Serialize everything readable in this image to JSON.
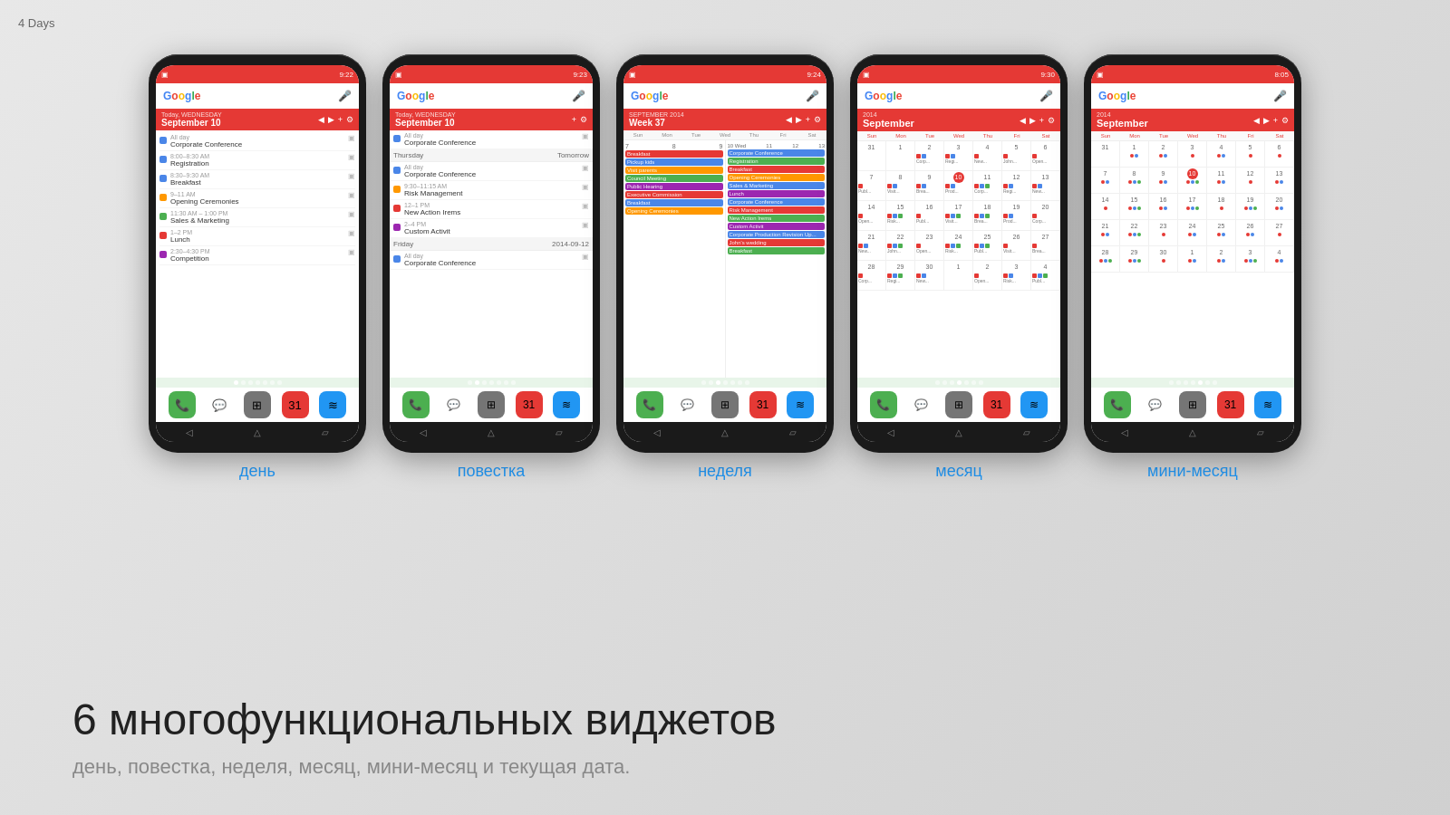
{
  "topbar": {
    "days_label": "4 Days"
  },
  "phones": [
    {
      "id": "day",
      "label": "день",
      "status_time": "9:22",
      "widget_type": "day",
      "header_day": "Today, WEDNESDAY",
      "header_date": "September 10",
      "events": [
        {
          "dot_color": "#4a86e8",
          "time": "All day",
          "title": "Corporate Conference",
          "allday": true
        },
        {
          "dot_color": "#4a86e8",
          "time": "8:00–8:30 AM",
          "title": "Registration"
        },
        {
          "dot_color": "#4a86e8",
          "time": "8:30–9:30 AM",
          "title": "Breakfast"
        },
        {
          "dot_color": "#ff9800",
          "time": "9–11 AM",
          "title": "Opening Ceremonies"
        },
        {
          "dot_color": "#4caf50",
          "time": "11:30 AM – 1:00 PM",
          "title": "Sales & Marketing"
        },
        {
          "dot_color": "#e53935",
          "time": "1–2 PM",
          "title": "Lunch"
        },
        {
          "dot_color": "#9c27b0",
          "time": "2:30–4:30 PM",
          "title": "Competition"
        }
      ]
    },
    {
      "id": "agenda",
      "label": "повестка",
      "status_time": "9:23",
      "widget_type": "agenda",
      "header_day": "Today, WEDNESDAY",
      "header_date": "September 10",
      "sections": [
        {
          "date_label": "",
          "date_right": "",
          "events": [
            {
              "dot_color": "#4a86e8",
              "time": "All day",
              "title": "Corporate Conference",
              "allday": true
            }
          ]
        },
        {
          "date_label": "Thursday",
          "date_right": "Tomorrow",
          "events": [
            {
              "dot_color": "#4a86e8",
              "time": "All day",
              "title": "Corporate Conference",
              "allday": true
            },
            {
              "dot_color": "#ff9800",
              "time": "9:30–11:15 AM",
              "title": "Risk Management"
            },
            {
              "dot_color": "#e53935",
              "time": "12–1 PM",
              "title": "New Action Irems"
            },
            {
              "dot_color": "#9c27b0",
              "time": "2–4 PM",
              "title": "Custom Activit"
            }
          ]
        },
        {
          "date_label": "Friday",
          "date_right": "2014-09-12",
          "events": [
            {
              "dot_color": "#4a86e8",
              "time": "All day",
              "title": "Corporate Conference",
              "allday": true
            }
          ]
        }
      ]
    },
    {
      "id": "week",
      "label": "неделя",
      "status_time": "9:24",
      "widget_type": "week",
      "header_month": "SEPTEMBER 2014",
      "header_week": "Week 37",
      "days": [
        "Sun",
        "Mon",
        "Tue",
        "Wed",
        "Thu",
        "Fri",
        "Sat"
      ],
      "left_events": [
        {
          "color": "#e53935",
          "text": "Breakfast"
        },
        {
          "color": "#4a86e8",
          "text": "Pickup kids"
        },
        {
          "color": "#ff9800",
          "text": "Visit parents"
        },
        {
          "color": "#4caf50",
          "text": "Council Meeting"
        },
        {
          "color": "#9c27b0",
          "text": "Public Hearing"
        },
        {
          "color": "#e53935",
          "text": "Executive Commission"
        },
        {
          "color": "#4a86e8",
          "text": "Breakfast"
        },
        {
          "color": "#ff9800",
          "text": "Opening Ceremonies"
        }
      ],
      "right_events": [
        {
          "color": "#4a86e8",
          "text": "Corporate Conference"
        },
        {
          "color": "#4caf50",
          "text": "Registration"
        },
        {
          "color": "#e53935",
          "text": "Breakfast"
        },
        {
          "color": "#ff9800",
          "text": "Opening Ceremonies"
        },
        {
          "color": "#4a86e8",
          "text": "Sales & Marketing"
        },
        {
          "color": "#9c27b0",
          "text": "Lunch"
        },
        {
          "color": "#4a86e8",
          "text": "Corporate Conference"
        },
        {
          "color": "#e53935",
          "text": "Risk Management"
        },
        {
          "color": "#4caf50",
          "text": "New Action Irems"
        },
        {
          "color": "#9c27b0",
          "text": "Custom Activit"
        },
        {
          "color": "#4a86e8",
          "text": "Corporate Production Revision Up..."
        },
        {
          "color": "#e53935",
          "text": "John's wedding"
        },
        {
          "color": "#4caf50",
          "text": "Breakfast"
        }
      ]
    },
    {
      "id": "month",
      "label": "месяц",
      "status_time": "9:30",
      "widget_type": "month",
      "header_year": "2014",
      "header_month": "September",
      "day_names": [
        "Sun",
        "Mon",
        "Tue",
        "Wed",
        "Thu",
        "Fri",
        "Sat"
      ],
      "weeks": [
        [
          "31",
          "1",
          "2",
          "3",
          "4",
          "5",
          "6"
        ],
        [
          "7",
          "8",
          "9",
          "10",
          "11",
          "12",
          "13"
        ],
        [
          "14",
          "15",
          "16",
          "17",
          "18",
          "19",
          "20"
        ],
        [
          "21",
          "22",
          "23",
          "24",
          "25",
          "26",
          "27"
        ],
        [
          "28",
          "29",
          "30",
          "1",
          "2",
          "3",
          "4"
        ]
      ]
    },
    {
      "id": "mini-month",
      "label": "мини-месяц",
      "status_time": "8:05",
      "widget_type": "mini-month",
      "header_year": "2014",
      "header_month": "September",
      "day_names": [
        "Sun",
        "Mon",
        "Tue",
        "Wed",
        "Thu",
        "Fri",
        "Sat"
      ],
      "weeks": [
        [
          "31",
          "1",
          "2",
          "3",
          "4",
          "5",
          "6"
        ],
        [
          "7",
          "8",
          "9",
          "10",
          "11",
          "12",
          "13"
        ],
        [
          "14",
          "15",
          "16",
          "17",
          "18",
          "19",
          "20"
        ],
        [
          "21",
          "22",
          "23",
          "24",
          "25",
          "26",
          "27"
        ],
        [
          "28",
          "29",
          "30",
          "1",
          "2",
          "3",
          "4"
        ]
      ]
    }
  ],
  "bottom": {
    "heading": "6 многофункциональных виджетов",
    "subheading": "день, повестка, неделя, месяц, мини-месяц и текущая дата."
  },
  "dock_icons": [
    "📞",
    "💬",
    "⊞",
    "📊",
    "≋"
  ],
  "colors": {
    "red": "#e53935",
    "blue": "#4a86e8",
    "green": "#4caf50",
    "orange": "#ff9800",
    "purple": "#9c27b0",
    "teal": "#00897b"
  }
}
